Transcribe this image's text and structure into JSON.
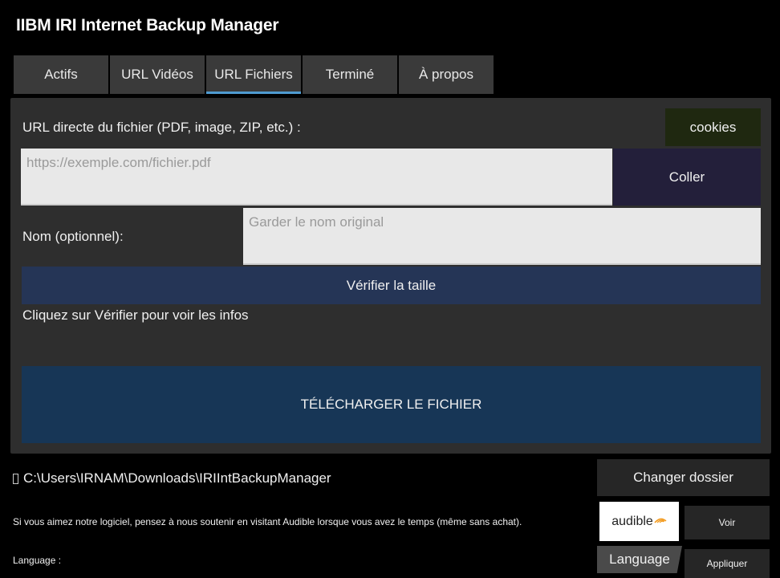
{
  "app": {
    "title": "IIBM IRI Internet Backup Manager"
  },
  "tabs": [
    {
      "label": "Actifs"
    },
    {
      "label": "URL Vidéos"
    },
    {
      "label": "URL Fichiers",
      "active": true
    },
    {
      "label": "Terminé"
    },
    {
      "label": "À propos"
    }
  ],
  "file_url": {
    "label": "URL directe du fichier (PDF, image, ZIP, etc.) :",
    "value": "",
    "placeholder": "https://exemple.com/fichier.pdf",
    "cookies_label": "cookies",
    "paste_label": "Coller"
  },
  "file_name": {
    "label": "Nom (optionnel):",
    "value": "",
    "placeholder": "Garder le nom original"
  },
  "verify": {
    "button_label": "Vérifier la taille",
    "info_text": "Cliquez sur Vérifier pour voir les infos"
  },
  "download": {
    "button_label": "TÉLÉCHARGER LE FICHIER"
  },
  "folder": {
    "icon": "folder-icon",
    "path": "C:\\Users\\IRNAM\\Downloads\\IRIIntBackupManager",
    "change_label": "Changer dossier"
  },
  "support": {
    "text": "Si vous aimez notre logiciel, pensez à nous soutenir en visitant Audible lorsque vous avez le temps (même sans achat).",
    "logo_text": "audible",
    "view_label": "Voir"
  },
  "language": {
    "label": "Language :",
    "selected": "Language",
    "apply_label": "Appliquer"
  },
  "colors": {
    "background": "#000000",
    "panel": "#2e2e2e",
    "tab_active_underline": "#4f9bd0",
    "verify_button": "#253556",
    "download_button": "#173656",
    "paste_button": "#231f3a",
    "cookies_button": "#1f2810"
  }
}
